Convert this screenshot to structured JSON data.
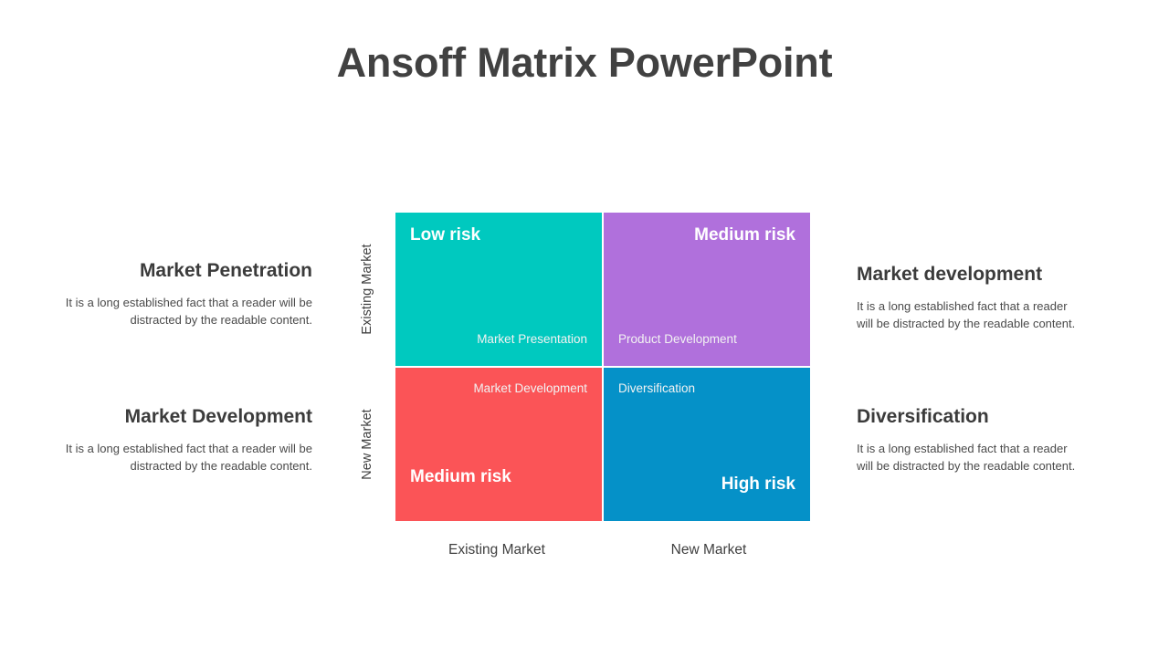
{
  "title": "Ansoff Matrix PowerPoint",
  "side_blocks": {
    "left_top": {
      "heading": "Market Penetration",
      "body": "It is a long established fact that a reader will be distracted by the readable content."
    },
    "left_bottom": {
      "heading": "Market Development",
      "body": "It is a long established fact that a reader will be distracted by the readable content."
    },
    "right_top": {
      "heading": "Market development",
      "body": "It is a long established fact that a reader will be distracted by the readable content."
    },
    "right_bottom": {
      "heading": "Diversification",
      "body": "It is a long established fact that a reader will be distracted by the readable content."
    }
  },
  "matrix": {
    "quadrants": [
      {
        "id": "market-presentation",
        "risk": "Low risk",
        "strategy": "Market Presentation",
        "color": "#00c9bf",
        "row": "Existing Market",
        "column": "Existing Market"
      },
      {
        "id": "product-development",
        "risk": "Medium risk",
        "strategy": "Product Development",
        "color": "#b070dc",
        "row": "Existing Market",
        "column": "New Market"
      },
      {
        "id": "market-development",
        "risk": "Medium risk",
        "strategy": "Market Development",
        "color": "#fb5457",
        "row": "New Market",
        "column": "Existing Market"
      },
      {
        "id": "diversification",
        "risk": "High risk",
        "strategy": "Diversification",
        "color": "#0591c8",
        "row": "New Market",
        "column": "New Market"
      }
    ],
    "axis_y": {
      "top": "Existing Market",
      "bottom": "New Market"
    },
    "axis_x": {
      "left": "Existing Market",
      "right": "New Market"
    }
  },
  "colors": {
    "teal": "#00c9bf",
    "purple": "#b070dc",
    "red": "#fb5457",
    "blue": "#0591c8",
    "title_text": "#414141",
    "body_text": "#4a4a4a",
    "background": "#ffffff"
  }
}
